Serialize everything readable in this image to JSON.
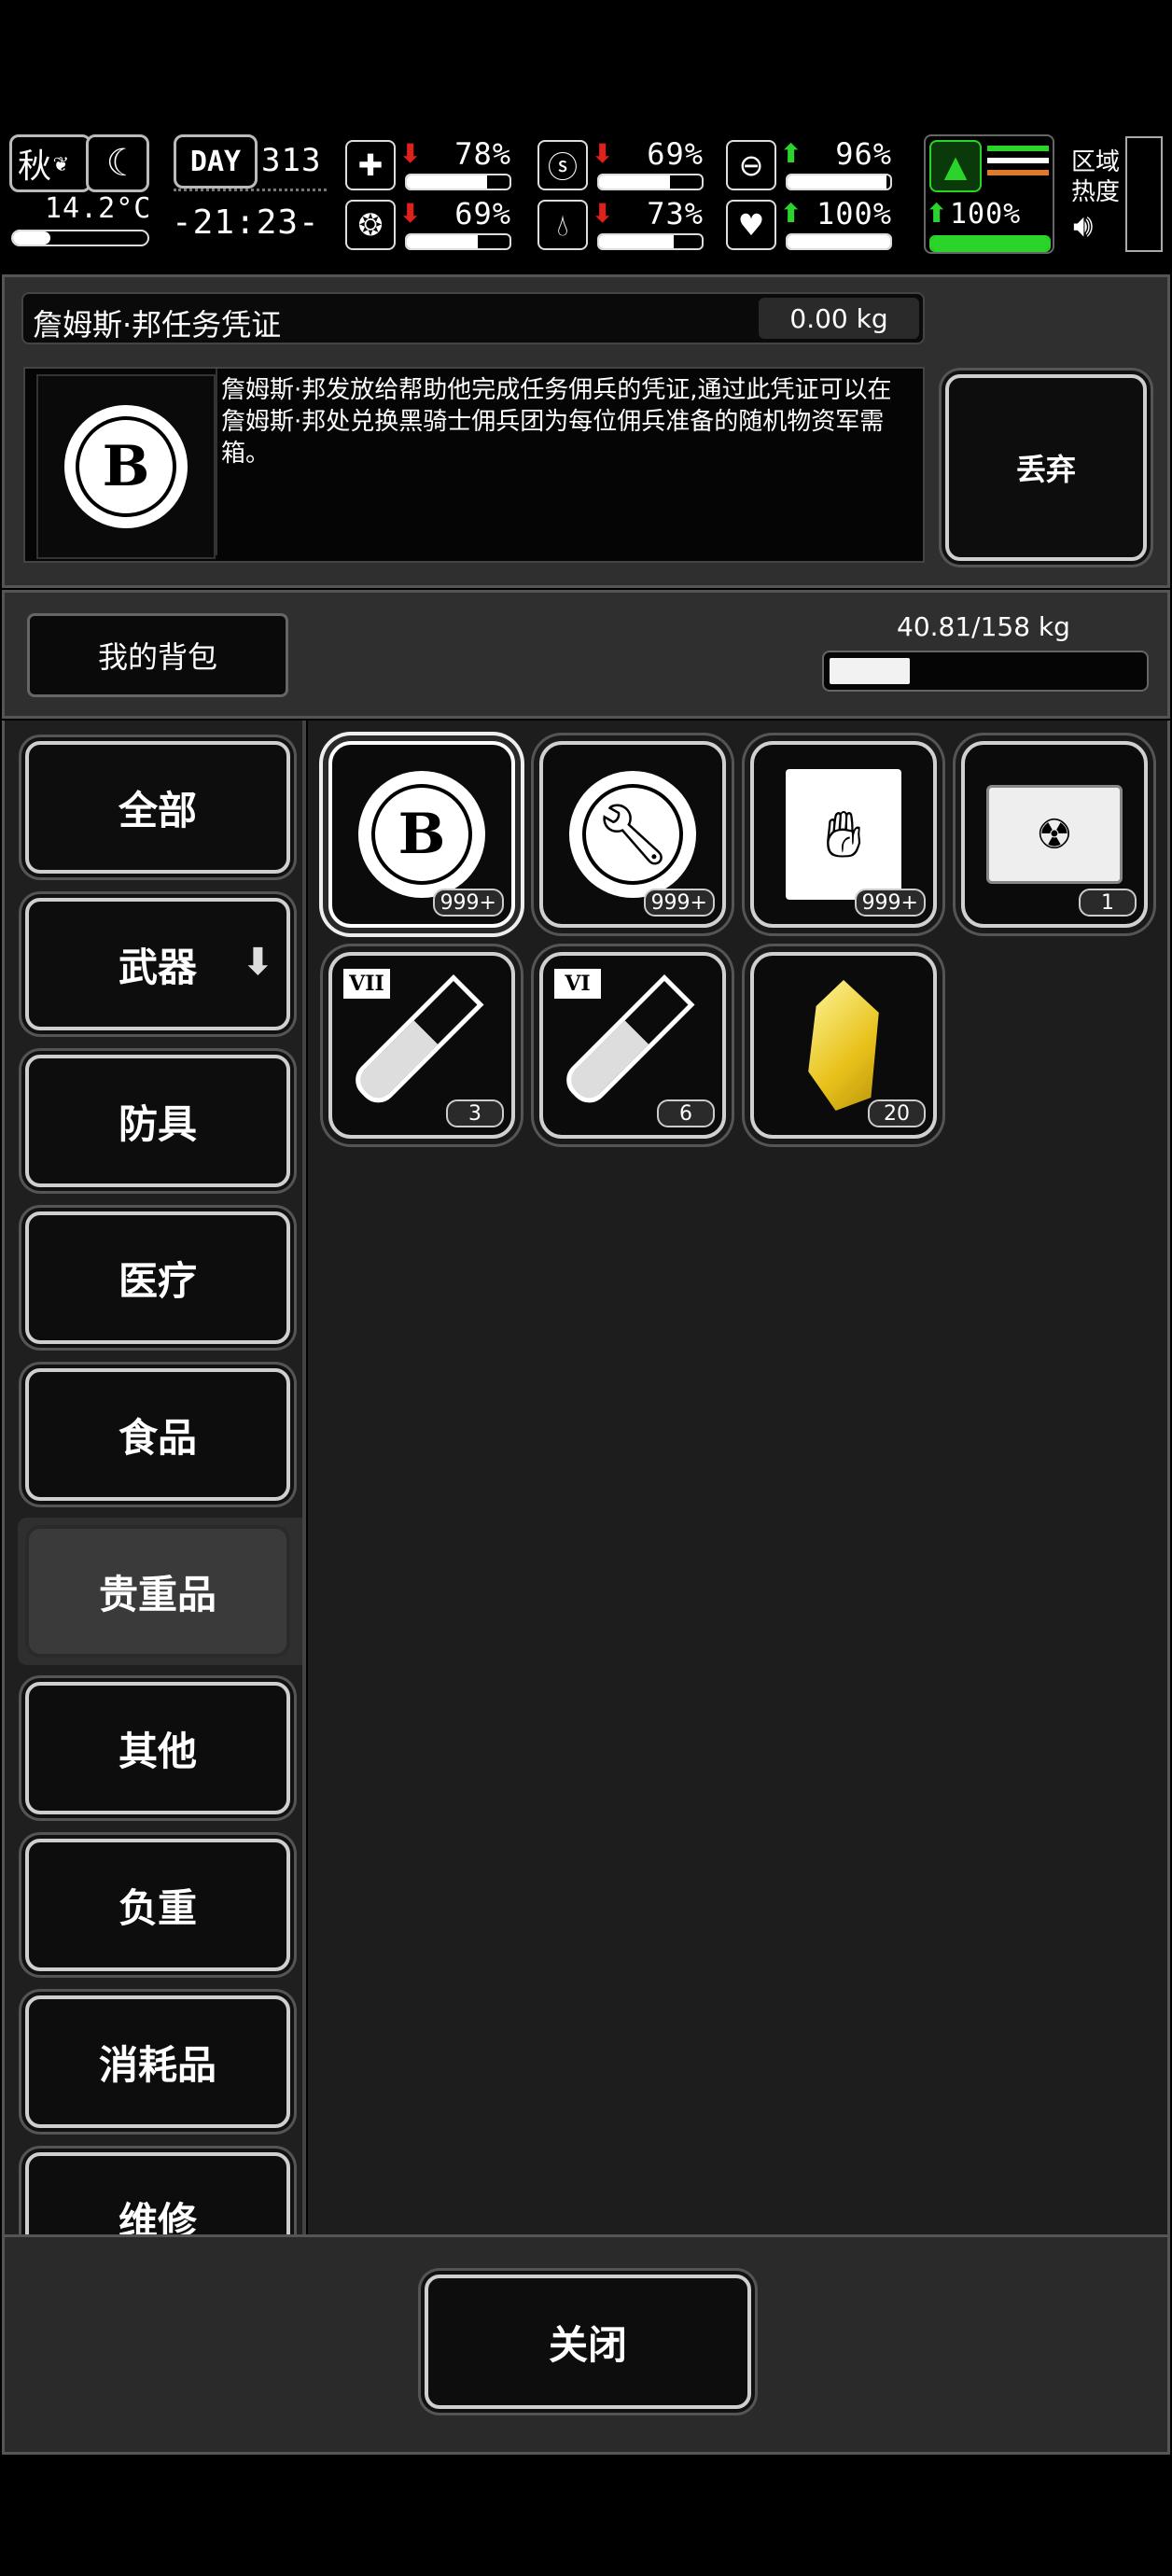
{
  "status": {
    "season": "秋",
    "temperature": "14.2°C",
    "day_label": "DAY",
    "day_number": "313",
    "clock": "-21:23-",
    "stats": [
      {
        "icon": "medkit-icon",
        "trend": "down",
        "value": "78%",
        "level": 0.78
      },
      {
        "icon": "stomach-icon",
        "trend": "down",
        "value": "69%",
        "level": 0.69
      },
      {
        "icon": "capsule-icon",
        "trend": "up",
        "value": "96%",
        "level": 0.96
      },
      {
        "icon": "brain-icon",
        "trend": "down",
        "value": "69%",
        "level": 0.69
      },
      {
        "icon": "water-drop-icon",
        "trend": "down",
        "value": "73%",
        "level": 0.73
      },
      {
        "icon": "heart-icon",
        "trend": "up",
        "value": "100%",
        "level": 1.0
      }
    ],
    "stamina_value": "100%",
    "stamina_level": 1.0,
    "zone_heat_label": "区域\n热度",
    "colors": {
      "down": "#e0201a",
      "up": "#2bd42b",
      "stamina": "#2bd42b",
      "heat": "#e07a2a"
    }
  },
  "item": {
    "name": "詹姆斯·邦任务凭证",
    "weight": "0.00 kg",
    "description": "詹姆斯·邦发放给帮助他完成任务佣兵的凭证,通过此凭证可以在詹姆斯·邦处兑换黑骑士佣兵团为每位佣兵准备的随机物资军需箱。",
    "discard_label": "丢弃"
  },
  "backpack": {
    "label": "我的背包",
    "capacity_text": "40.81/158 kg",
    "capacity_fraction": 0.258
  },
  "categories": [
    {
      "label": "全部",
      "selected": false
    },
    {
      "label": "武器",
      "selected": false
    },
    {
      "label": "防具",
      "selected": false
    },
    {
      "label": "医疗",
      "selected": false
    },
    {
      "label": "食品",
      "selected": false
    },
    {
      "label": "贵重品",
      "selected": true
    },
    {
      "label": "其他",
      "selected": false
    },
    {
      "label": "负重",
      "selected": false
    },
    {
      "label": "消耗品",
      "selected": false
    },
    {
      "label": "维修",
      "selected": false
    }
  ],
  "items": [
    {
      "icon": "b-coin-icon",
      "count": "999+",
      "selected": true
    },
    {
      "icon": "wrench-coin-icon",
      "count": "999+",
      "selected": false
    },
    {
      "icon": "zombie-hand-card-icon",
      "count": "999+",
      "selected": false
    },
    {
      "icon": "supply-chest-icon",
      "count": "1",
      "selected": false
    },
    {
      "icon": "test-tube-vii-icon",
      "tier": "VII",
      "count": "3",
      "selected": false
    },
    {
      "icon": "test-tube-vi-icon",
      "tier": "VI",
      "count": "6",
      "selected": false
    },
    {
      "icon": "gold-crystal-icon",
      "count": "20",
      "selected": false
    }
  ],
  "close_label": "关闭"
}
